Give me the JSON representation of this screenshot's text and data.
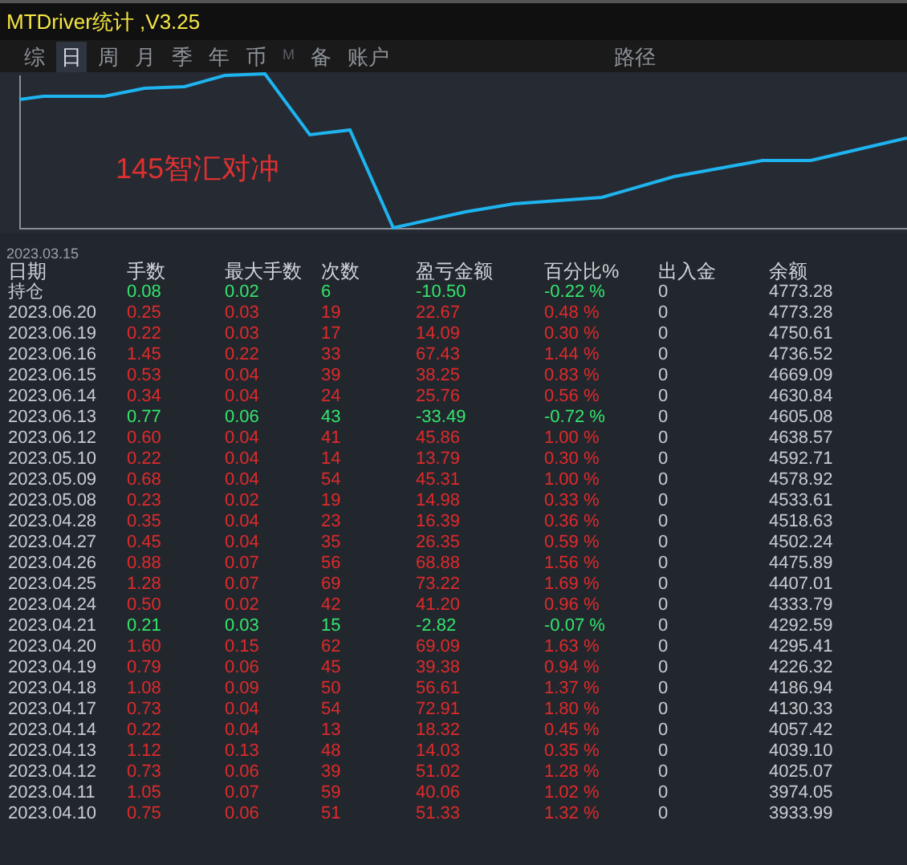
{
  "window": {
    "title": "MTDriver统计 ,V3.25"
  },
  "tabs": [
    {
      "label": "综",
      "selected": false,
      "disabled": false
    },
    {
      "label": "日",
      "selected": true,
      "disabled": false
    },
    {
      "label": "周",
      "selected": false,
      "disabled": false
    },
    {
      "label": "月",
      "selected": false,
      "disabled": false
    },
    {
      "label": "季",
      "selected": false,
      "disabled": false
    },
    {
      "label": "年",
      "selected": false,
      "disabled": false
    },
    {
      "label": "币",
      "selected": false,
      "disabled": false
    },
    {
      "label": "M",
      "selected": false,
      "disabled": true
    },
    {
      "label": "备",
      "selected": false,
      "disabled": false
    },
    {
      "label": "账户",
      "selected": false,
      "disabled": false
    },
    {
      "label": "路径",
      "selected": false,
      "disabled": false
    }
  ],
  "chart": {
    "label": "145智汇对冲",
    "start_date": "2023.03.15"
  },
  "table": {
    "columns": [
      "日期",
      "手数",
      "最大手数",
      "次数",
      "盈亏金额",
      "百分比%",
      "出入金",
      "余额"
    ],
    "rows": [
      {
        "loss": true,
        "cells": [
          "持仓",
          "0.08",
          "0.02",
          "6",
          "-10.50",
          "-0.22 %",
          "0",
          "4773.28"
        ]
      },
      {
        "loss": false,
        "cells": [
          "2023.06.20",
          "0.25",
          "0.03",
          "19",
          "22.67",
          "0.48 %",
          "0",
          "4773.28"
        ]
      },
      {
        "loss": false,
        "cells": [
          "2023.06.19",
          "0.22",
          "0.03",
          "17",
          "14.09",
          "0.30 %",
          "0",
          "4750.61"
        ]
      },
      {
        "loss": false,
        "cells": [
          "2023.06.16",
          "1.45",
          "0.22",
          "33",
          "67.43",
          "1.44 %",
          "0",
          "4736.52"
        ]
      },
      {
        "loss": false,
        "cells": [
          "2023.06.15",
          "0.53",
          "0.04",
          "39",
          "38.25",
          "0.83 %",
          "0",
          "4669.09"
        ]
      },
      {
        "loss": false,
        "cells": [
          "2023.06.14",
          "0.34",
          "0.04",
          "24",
          "25.76",
          "0.56 %",
          "0",
          "4630.84"
        ]
      },
      {
        "loss": true,
        "cells": [
          "2023.06.13",
          "0.77",
          "0.06",
          "43",
          "-33.49",
          "-0.72 %",
          "0",
          "4605.08"
        ]
      },
      {
        "loss": false,
        "cells": [
          "2023.06.12",
          "0.60",
          "0.04",
          "41",
          "45.86",
          "1.00 %",
          "0",
          "4638.57"
        ]
      },
      {
        "loss": false,
        "cells": [
          "2023.05.10",
          "0.22",
          "0.04",
          "14",
          "13.79",
          "0.30 %",
          "0",
          "4592.71"
        ]
      },
      {
        "loss": false,
        "cells": [
          "2023.05.09",
          "0.68",
          "0.04",
          "54",
          "45.31",
          "1.00 %",
          "0",
          "4578.92"
        ]
      },
      {
        "loss": false,
        "cells": [
          "2023.05.08",
          "0.23",
          "0.02",
          "19",
          "14.98",
          "0.33 %",
          "0",
          "4533.61"
        ]
      },
      {
        "loss": false,
        "cells": [
          "2023.04.28",
          "0.35",
          "0.04",
          "23",
          "16.39",
          "0.36 %",
          "0",
          "4518.63"
        ]
      },
      {
        "loss": false,
        "cells": [
          "2023.04.27",
          "0.45",
          "0.04",
          "35",
          "26.35",
          "0.59 %",
          "0",
          "4502.24"
        ]
      },
      {
        "loss": false,
        "cells": [
          "2023.04.26",
          "0.88",
          "0.07",
          "56",
          "68.88",
          "1.56 %",
          "0",
          "4475.89"
        ]
      },
      {
        "loss": false,
        "cells": [
          "2023.04.25",
          "1.28",
          "0.07",
          "69",
          "73.22",
          "1.69 %",
          "0",
          "4407.01"
        ]
      },
      {
        "loss": false,
        "cells": [
          "2023.04.24",
          "0.50",
          "0.02",
          "42",
          "41.20",
          "0.96 %",
          "0",
          "4333.79"
        ]
      },
      {
        "loss": true,
        "cells": [
          "2023.04.21",
          "0.21",
          "0.03",
          "15",
          "-2.82",
          "-0.07 %",
          "0",
          "4292.59"
        ]
      },
      {
        "loss": false,
        "cells": [
          "2023.04.20",
          "1.60",
          "0.15",
          "62",
          "69.09",
          "1.63 %",
          "0",
          "4295.41"
        ]
      },
      {
        "loss": false,
        "cells": [
          "2023.04.19",
          "0.79",
          "0.06",
          "45",
          "39.38",
          "0.94 %",
          "0",
          "4226.32"
        ]
      },
      {
        "loss": false,
        "cells": [
          "2023.04.18",
          "1.08",
          "0.09",
          "50",
          "56.61",
          "1.37 %",
          "0",
          "4186.94"
        ]
      },
      {
        "loss": false,
        "cells": [
          "2023.04.17",
          "0.73",
          "0.04",
          "54",
          "72.91",
          "1.80 %",
          "0",
          "4130.33"
        ]
      },
      {
        "loss": false,
        "cells": [
          "2023.04.14",
          "0.22",
          "0.04",
          "13",
          "18.32",
          "0.45 %",
          "0",
          "4057.42"
        ]
      },
      {
        "loss": false,
        "cells": [
          "2023.04.13",
          "1.12",
          "0.13",
          "48",
          "14.03",
          "0.35 %",
          "0",
          "4039.10"
        ]
      },
      {
        "loss": false,
        "cells": [
          "2023.04.12",
          "0.73",
          "0.06",
          "39",
          "51.02",
          "1.28 %",
          "0",
          "4025.07"
        ]
      },
      {
        "loss": false,
        "cells": [
          "2023.04.11",
          "1.05",
          "0.07",
          "59",
          "40.06",
          "1.02 %",
          "0",
          "3974.05"
        ]
      },
      {
        "loss": false,
        "cells": [
          "2023.04.10",
          "0.75",
          "0.06",
          "51",
          "51.33",
          "1.32 %",
          "0",
          "3933.99"
        ]
      }
    ]
  }
}
